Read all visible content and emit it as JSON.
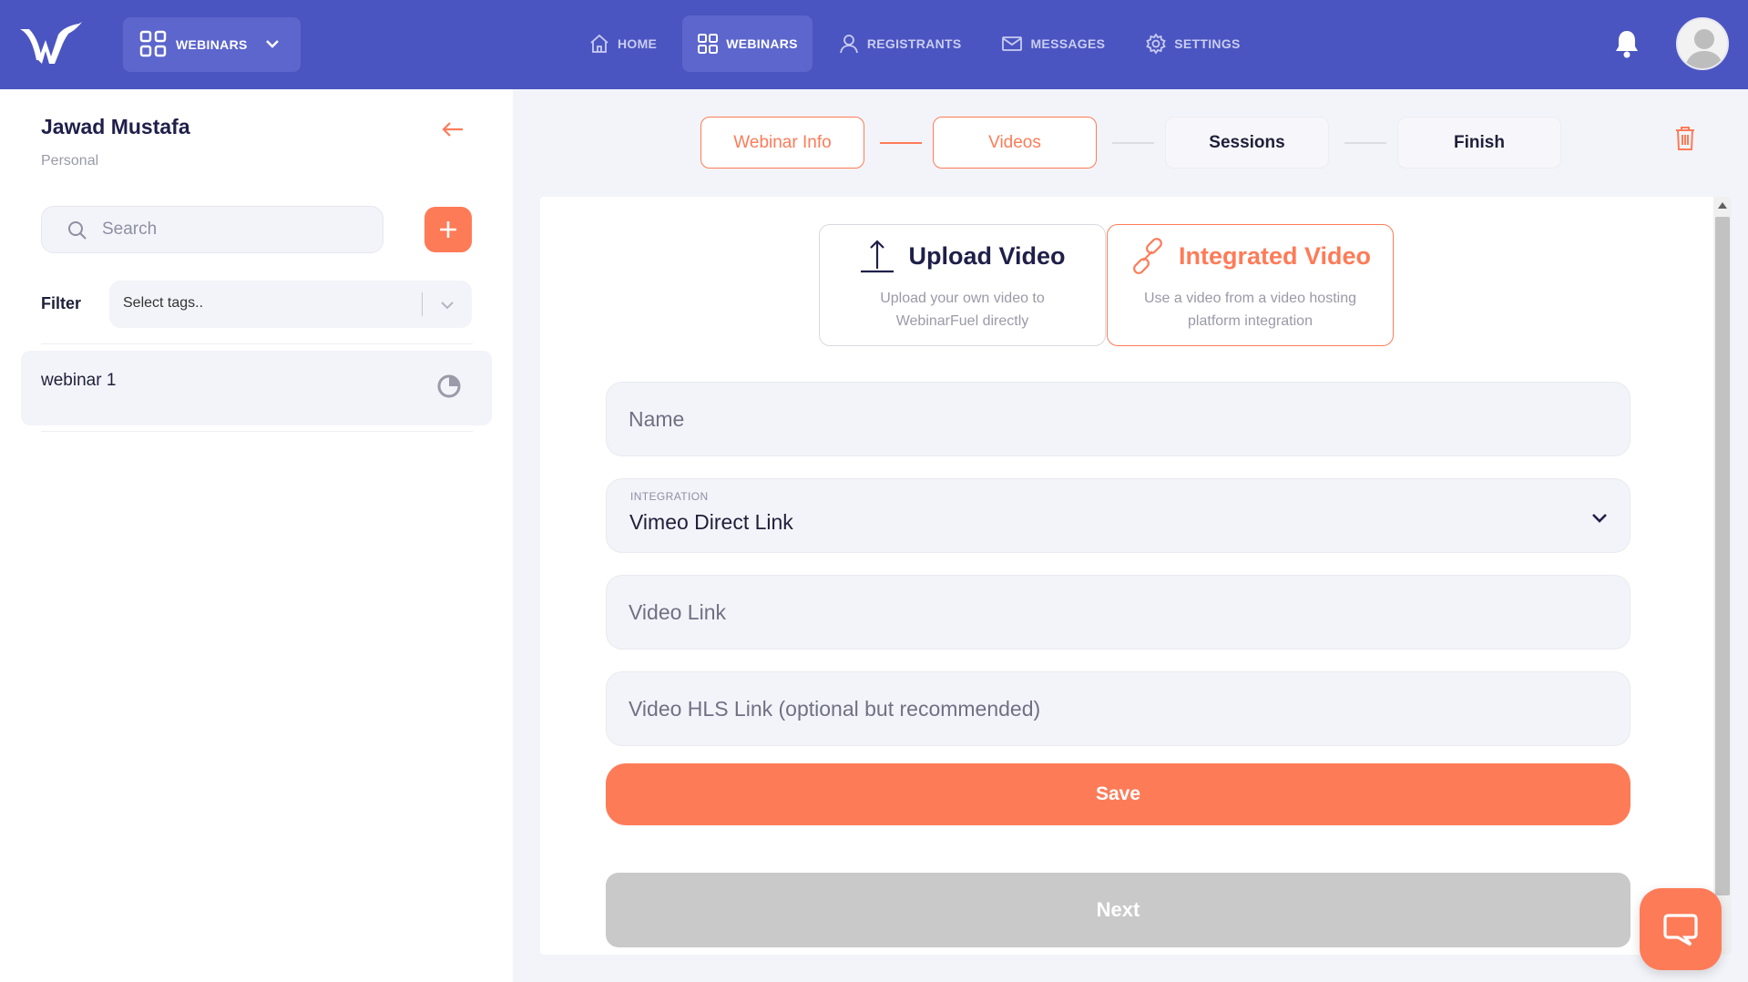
{
  "colors": {
    "topbar": "#4b55c1",
    "accent": "#fe7b58",
    "muted_bg": "#f3f4f9",
    "disabled": "#c9c9c9"
  },
  "header": {
    "app_switcher": {
      "label": "WEBINARS",
      "icon": "grid-icon"
    },
    "nav": [
      {
        "label": "HOME",
        "icon": "home-icon",
        "active": false
      },
      {
        "label": "WEBINARS",
        "icon": "grid-icon",
        "active": true
      },
      {
        "label": "REGISTRANTS",
        "icon": "user-icon",
        "active": false
      },
      {
        "label": "MESSAGES",
        "icon": "mail-icon",
        "active": false
      },
      {
        "label": "SETTINGS",
        "icon": "gear-icon",
        "active": false
      }
    ]
  },
  "sidebar": {
    "user_name": "Jawad Mustafa",
    "user_sub": "Personal",
    "search_placeholder": "Search",
    "filter_label": "Filter",
    "tags_placeholder": "Select tags..",
    "items": [
      {
        "label": "webinar 1",
        "icon": "pie-clock-icon"
      }
    ]
  },
  "steps": [
    {
      "label": "Webinar Info",
      "state": "done"
    },
    {
      "label": "Videos",
      "state": "done"
    },
    {
      "label": "Sessions",
      "state": "todo"
    },
    {
      "label": "Finish",
      "state": "todo"
    }
  ],
  "video_types": {
    "upload": {
      "title": "Upload Video",
      "desc": "Upload your own video to WebinarFuel directly",
      "icon": "upload-icon"
    },
    "integrated": {
      "title": "Integrated Video",
      "desc": "Use a video from a video hosting platform integration",
      "icon": "link-icon",
      "selected": true
    }
  },
  "form": {
    "name_placeholder": "Name",
    "integration_label": "INTEGRATION",
    "integration_value": "Vimeo Direct Link",
    "video_link_placeholder": "Video Link",
    "hls_placeholder": "Video HLS Link (optional but recommended)",
    "save_label": "Save",
    "next_label": "Next"
  }
}
